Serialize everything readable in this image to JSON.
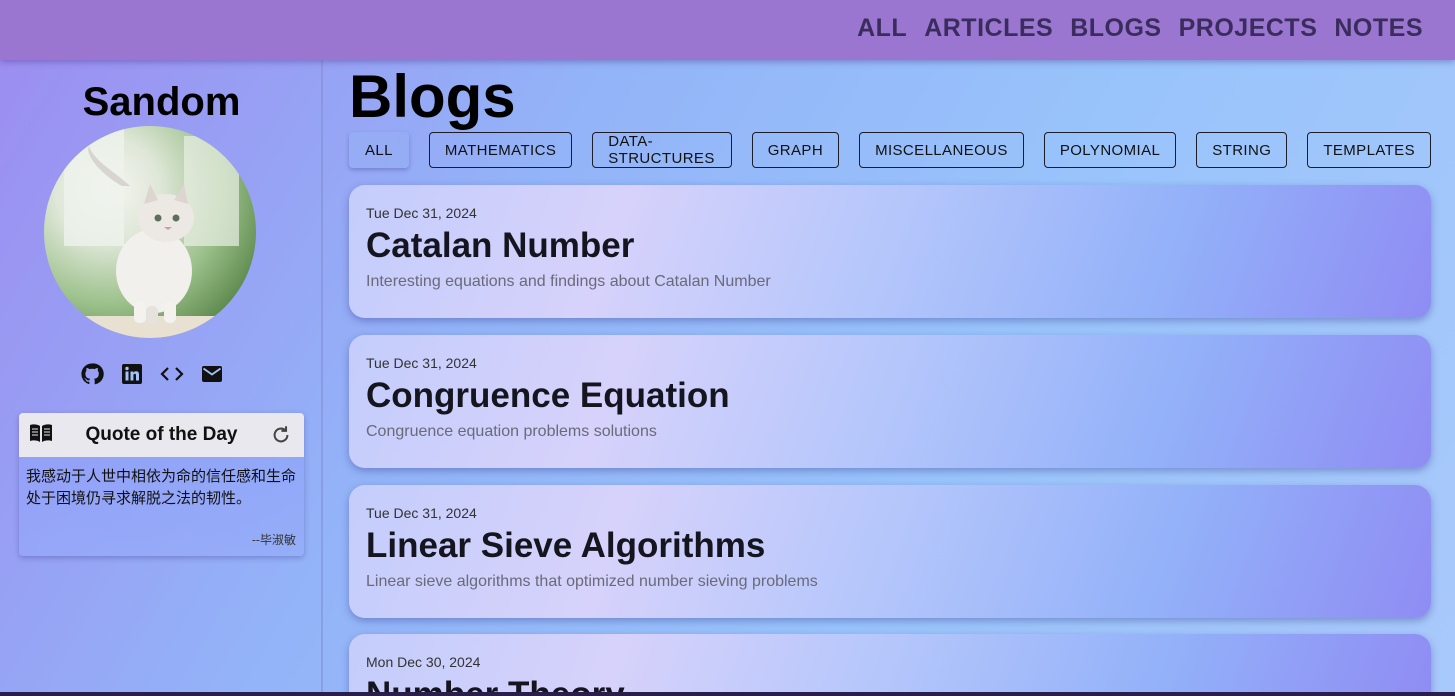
{
  "nav": {
    "items": [
      "ALL",
      "ARTICLES",
      "BLOGS",
      "PROJECTS",
      "NOTES"
    ]
  },
  "sidebar": {
    "brand": "Sandom",
    "avatar_icon": "cat-avatar-icon",
    "social": [
      "github-icon",
      "linkedin-icon",
      "code-icon",
      "mail-icon"
    ],
    "quote": {
      "title": "Quote of the Day",
      "text": "我感动于人世中相依为命的信任感和生命处于困境仍寻求解脱之法的韧性。",
      "author": "--毕淑敏"
    }
  },
  "main": {
    "title": "Blogs",
    "filters": [
      "ALL",
      "MATHEMATICS",
      "DATA-STRUCTURES",
      "GRAPH",
      "MISCELLANEOUS",
      "POLYNOMIAL",
      "STRING",
      "TEMPLATES"
    ],
    "active_filter": "ALL",
    "posts": [
      {
        "date": "Tue Dec 31, 2024",
        "title": "Catalan Number",
        "desc": "Interesting equations and findings about Catalan Number"
      },
      {
        "date": "Tue Dec 31, 2024",
        "title": "Congruence Equation",
        "desc": "Congruence equation problems solutions"
      },
      {
        "date": "Tue Dec 31, 2024",
        "title": "Linear Sieve Algorithms",
        "desc": "Linear sieve algorithms that optimized number sieving problems"
      },
      {
        "date": "Mon Dec 30, 2024",
        "title": "Number Theory",
        "desc": ""
      }
    ]
  }
}
